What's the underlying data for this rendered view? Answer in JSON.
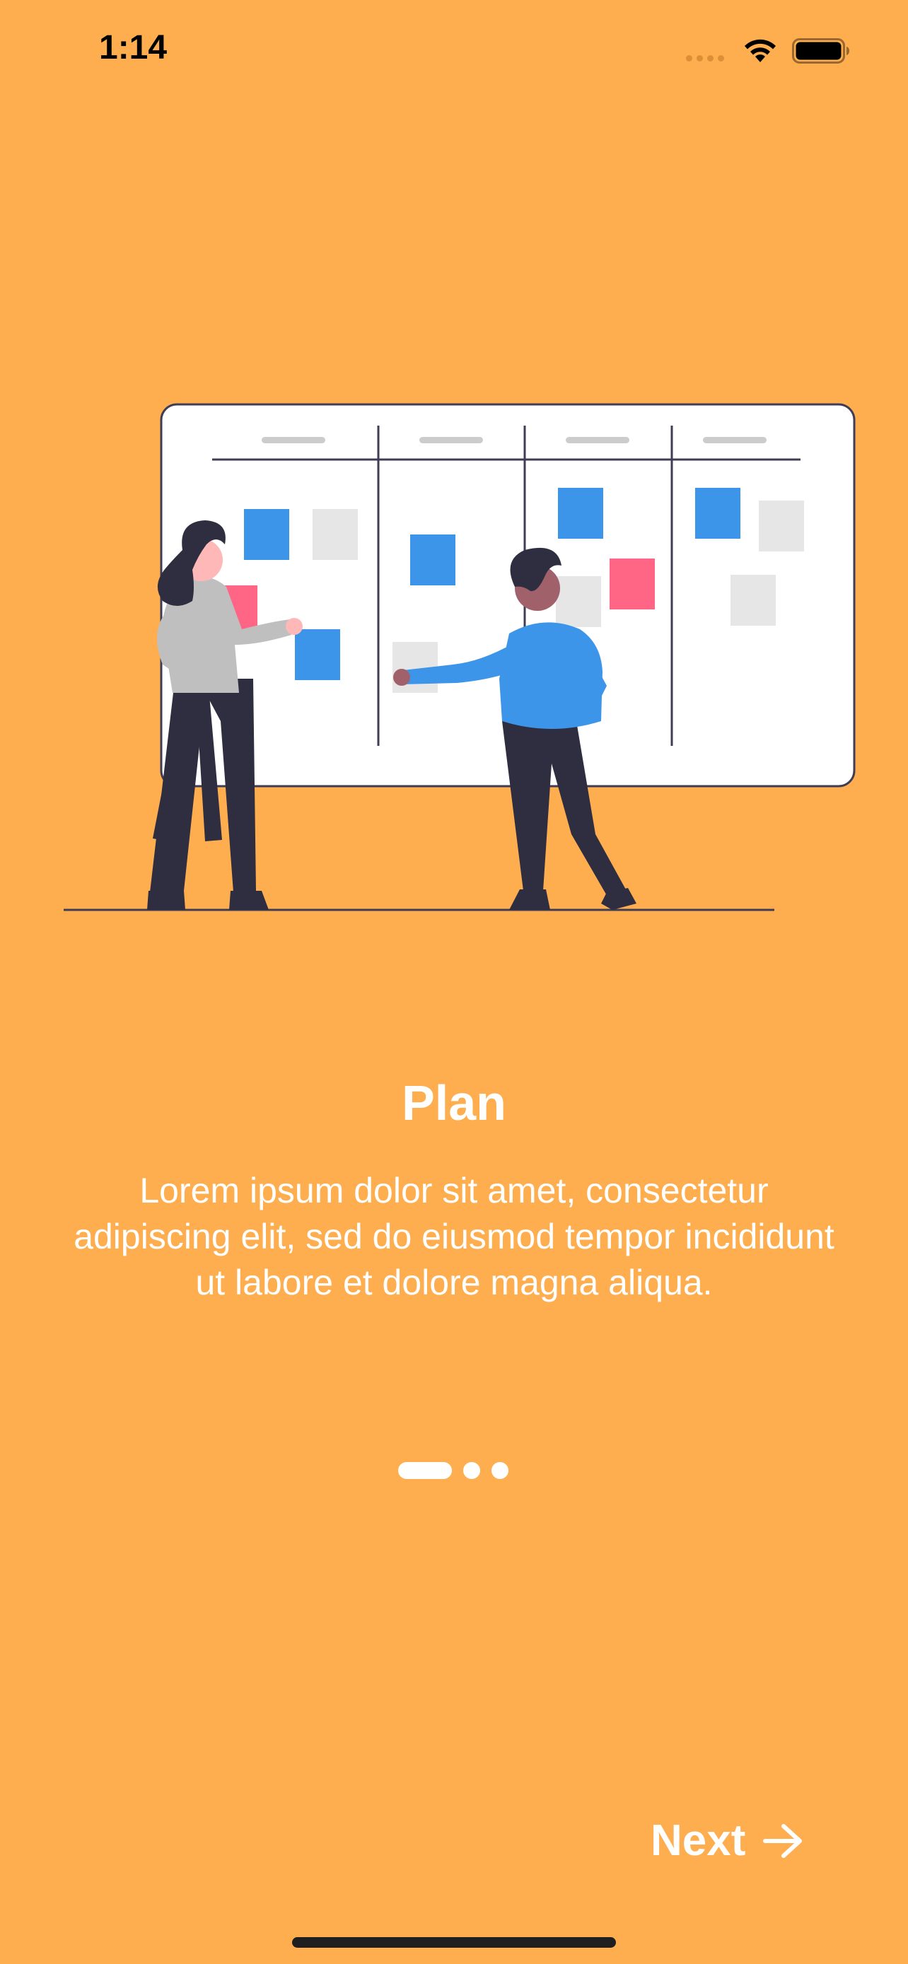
{
  "status_bar": {
    "time": "1:14"
  },
  "onboarding": {
    "title": "Plan",
    "body": "Lorem ipsum dolor sit amet, consectetur adipiscing elit, sed do eiusmod tempor incididunt ut labore et dolore magna aliqua.",
    "page_count": 3,
    "current_page": 1,
    "next_label": "Next"
  },
  "icons": {
    "cellular": "cellular-signal-icon",
    "wifi": "wifi-icon",
    "battery": "battery-icon",
    "next_arrow": "arrow-right-icon"
  },
  "colors": {
    "background": "#FEAE4F",
    "text": "#FFFFFF",
    "board_blue": "#3D95EA",
    "board_pink": "#FF6584",
    "board_gray": "#E6E6E6",
    "dark": "#2F2E41"
  }
}
